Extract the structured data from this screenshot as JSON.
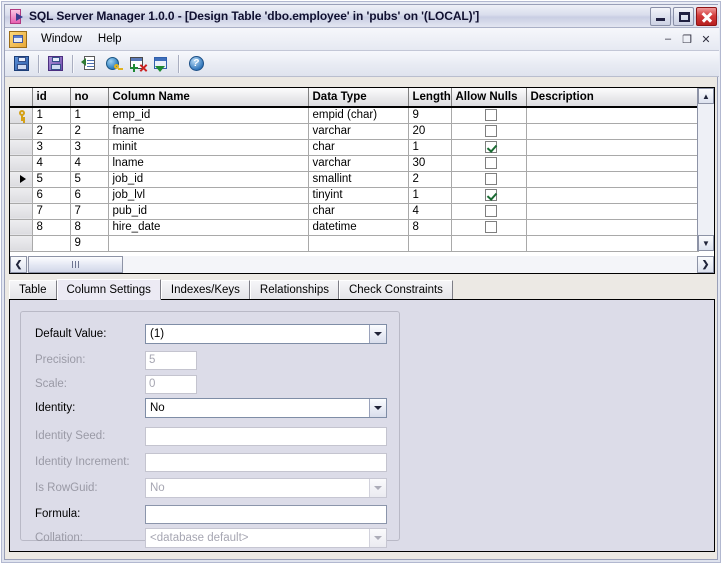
{
  "window": {
    "title": "SQL Server Manager 1.0.0 - [Design Table 'dbo.employee' in 'pubs' on '(LOCAL)']",
    "app_icon": "sql-manager-icon",
    "buttons": {
      "minimize": "–",
      "maximize": "□",
      "close": "✕"
    }
  },
  "menu": {
    "mdi_icon": "child-window-icon",
    "items": [
      {
        "label": "Window"
      },
      {
        "label": "Help"
      }
    ],
    "mdi_buttons": {
      "minimize": "–",
      "restore": "❐",
      "close": "✕"
    }
  },
  "toolbar": {
    "items": [
      {
        "name": "save-button",
        "icon": "save-floppy-icon",
        "tooltip": "Save"
      },
      {
        "name": "save-change-script-button",
        "icon": "save-script-floppy-icon",
        "tooltip": "Generate Change Script"
      },
      {
        "name": "properties-button",
        "icon": "properties-document-icon",
        "tooltip": "Properties"
      },
      {
        "name": "manage-relationships-button",
        "icon": "globe-key-icon",
        "tooltip": "Manage Relationships"
      },
      {
        "name": "manage-indexes-button",
        "icon": "grid-plus-delete-icon",
        "tooltip": "Manage Indexes/Keys"
      },
      {
        "name": "manage-constraints-button",
        "icon": "window-green-arrow-icon",
        "tooltip": "Manage Check Constraints"
      },
      {
        "name": "help-button",
        "icon": "help-question-icon",
        "tooltip": "Help"
      }
    ]
  },
  "grid": {
    "columns": [
      {
        "key": "marker",
        "label": ""
      },
      {
        "key": "id",
        "label": "id"
      },
      {
        "key": "no",
        "label": "no"
      },
      {
        "key": "column_name",
        "label": "Column Name"
      },
      {
        "key": "data_type",
        "label": "Data Type"
      },
      {
        "key": "length",
        "label": "Length"
      },
      {
        "key": "allow_nulls",
        "label": "Allow Nulls"
      },
      {
        "key": "description",
        "label": "Description"
      }
    ],
    "rows": [
      {
        "marker": "key",
        "id": "1",
        "no": "1",
        "column_name": "emp_id",
        "data_type": "empid (char)",
        "length": "9",
        "allow_nulls": false,
        "description": ""
      },
      {
        "marker": "",
        "id": "2",
        "no": "2",
        "column_name": "fname",
        "data_type": "varchar",
        "length": "20",
        "allow_nulls": false,
        "description": ""
      },
      {
        "marker": "",
        "id": "3",
        "no": "3",
        "column_name": "minit",
        "data_type": "char",
        "length": "1",
        "allow_nulls": true,
        "description": ""
      },
      {
        "marker": "",
        "id": "4",
        "no": "4",
        "column_name": "lname",
        "data_type": "varchar",
        "length": "30",
        "allow_nulls": false,
        "description": ""
      },
      {
        "marker": "current",
        "id": "5",
        "no": "5",
        "column_name": "job_id",
        "data_type": "smallint",
        "length": "2",
        "allow_nulls": false,
        "description": ""
      },
      {
        "marker": "",
        "id": "6",
        "no": "6",
        "column_name": "job_lvl",
        "data_type": "tinyint",
        "length": "1",
        "allow_nulls": true,
        "description": ""
      },
      {
        "marker": "",
        "id": "7",
        "no": "7",
        "column_name": "pub_id",
        "data_type": "char",
        "length": "4",
        "allow_nulls": false,
        "description": ""
      },
      {
        "marker": "",
        "id": "8",
        "no": "8",
        "column_name": "hire_date",
        "data_type": "datetime",
        "length": "8",
        "allow_nulls": false,
        "description": ""
      },
      {
        "marker": "",
        "id": "",
        "no": "9",
        "column_name": "",
        "data_type": "",
        "length": "",
        "allow_nulls": false,
        "description": ""
      }
    ],
    "vscroll": {
      "up": "▲",
      "down": "▼"
    },
    "hscroll": {
      "left": "❮",
      "right": "❯"
    }
  },
  "tabs": [
    {
      "label": "Table",
      "active": false
    },
    {
      "label": "Column Settings",
      "active": true
    },
    {
      "label": "Indexes/Keys",
      "active": false
    },
    {
      "label": "Relationships",
      "active": false
    },
    {
      "label": "Check Constraints",
      "active": false
    }
  ],
  "column_settings": {
    "fields": [
      {
        "name": "default-value",
        "label": "Default Value:",
        "type": "combo",
        "value": "(1)",
        "disabled": false,
        "width": "full"
      },
      {
        "name": "precision",
        "label": "Precision:",
        "type": "text",
        "value": "5",
        "disabled": true,
        "width": "small"
      },
      {
        "name": "scale",
        "label": "Scale:",
        "type": "text",
        "value": "0",
        "disabled": true,
        "width": "small"
      },
      {
        "name": "identity",
        "label": "Identity:",
        "type": "combo",
        "value": "No",
        "disabled": false,
        "width": "full"
      },
      {
        "name": "identity-seed",
        "label": "Identity Seed:",
        "type": "text",
        "value": "",
        "disabled": true,
        "width": "full"
      },
      {
        "name": "identity-increment",
        "label": "Identity Increment:",
        "type": "text",
        "value": "",
        "disabled": true,
        "width": "full"
      },
      {
        "name": "is-rowguid",
        "label": "Is RowGuid:",
        "type": "combo",
        "value": "No",
        "disabled": true,
        "width": "full"
      },
      {
        "name": "formula",
        "label": "Formula:",
        "type": "text",
        "value": "",
        "disabled": false,
        "width": "full"
      },
      {
        "name": "collation",
        "label": "Collation:",
        "type": "combo",
        "value": "<database default>",
        "disabled": true,
        "width": "full"
      }
    ]
  }
}
